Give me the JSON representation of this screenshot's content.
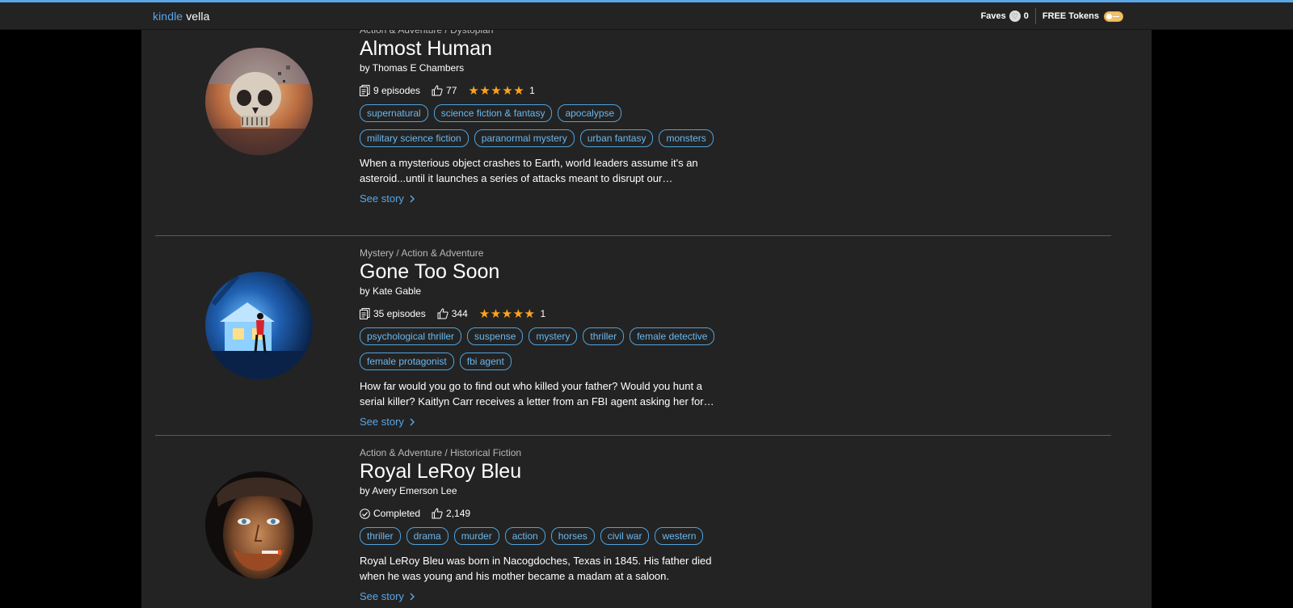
{
  "header": {
    "brand_kindle": "kindle",
    "brand_vella": "vella",
    "faves_label": "Faves",
    "faves_count": "0",
    "tokens_label": "FREE Tokens"
  },
  "colors": {
    "accent": "#5aa6e6",
    "star": "#ffa41c",
    "background": "#232323"
  },
  "stories": [
    {
      "genre": "Action & Adventure / Dystopian",
      "title": "Almost Human",
      "author": "by Thomas E Chambers",
      "episodes": "9 episodes",
      "likes": "77",
      "rating_stars": 5,
      "rating_count": "1",
      "tags": [
        "supernatural",
        "science fiction & fantasy",
        "apocalypse",
        "military science fiction",
        "paranormal mystery",
        "urban fantasy",
        "monsters"
      ],
      "description": "When a mysterious object crashes to Earth, world leaders assume it's an asteroid...until it launches a series of attacks meant to disrupt our civilization.",
      "see_story": "See story"
    },
    {
      "genre": "Mystery / Action & Adventure",
      "title": "Gone Too Soon",
      "author": "by Kate Gable",
      "episodes": "35 episodes",
      "likes": "344",
      "rating_stars": 5,
      "rating_count": "1",
      "tags": [
        "psychological thriller",
        "suspense",
        "mystery",
        "thriller",
        "female detective",
        "female protagonist",
        "fbi agent"
      ],
      "description": "How far would you go to find out who killed your father? Would you hunt a serial killer? Kaitlyn Carr receives a letter from an FBI agent asking her for help.",
      "see_story": "See story"
    },
    {
      "genre": "Action & Adventure / Historical Fiction",
      "title": "Royal LeRoy Bleu",
      "author": "by Avery Emerson Lee",
      "status": "Completed",
      "likes": "2,149",
      "tags": [
        "thriller",
        "drama",
        "murder",
        "action",
        "horses",
        "civil war",
        "western"
      ],
      "description": "Royal LeRoy Bleu was born in Nacogdoches, Texas in 1845. His father died when he was young and his mother became a madam at a saloon.",
      "see_story": "See story"
    }
  ]
}
